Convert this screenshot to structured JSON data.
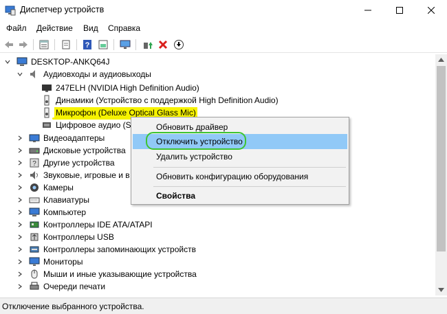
{
  "window": {
    "title": "Диспетчер устройств"
  },
  "menu": [
    "Файл",
    "Действие",
    "Вид",
    "Справка"
  ],
  "toolbar": [
    "back",
    "forward",
    "properties",
    "show-hidden",
    "help",
    "refresh",
    "monitor",
    "update-driver",
    "uninstall",
    "disable"
  ],
  "tree": {
    "root": "DESKTOP-ANKQ64J",
    "audio_group": "Аудиовходы и аудиовыходы",
    "audio_children": [
      "247ELH (NVIDIA High Definition Audio)",
      "Динамики (Устройство с поддержкой High Definition Audio)",
      "Микрофон (Deluxe Optical Glass Mic)",
      "Цифровое аудио (S/"
    ],
    "categories": [
      "Видеоадаптеры",
      "Дисковые устройства",
      "Другие устройства",
      "Звуковые, игровые и в",
      "Камеры",
      "Клавиатуры",
      "Компьютер",
      "Контроллеры IDE ATA/ATAPI",
      "Контроллеры USB",
      "Контроллеры запоминающих устройств",
      "Мониторы",
      "Мыши и иные указывающие устройства",
      "Очереди печати"
    ]
  },
  "context_menu": {
    "update_driver": "Обновить драйвер",
    "disable_device": "Отключить устройство",
    "uninstall_device": "Удалить устройство",
    "scan_hardware": "Обновить конфигурацию оборудования",
    "properties": "Свойства"
  },
  "status_bar": "Отключение выбранного устройства.",
  "colors": {
    "highlight_yellow": "#f6f200",
    "annotation_green": "#3ec431",
    "menu_active": "#91c9f7"
  }
}
